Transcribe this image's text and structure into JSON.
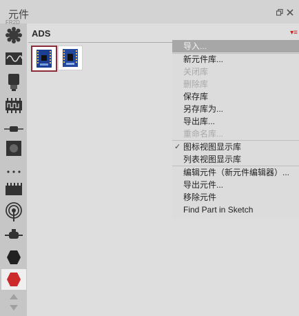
{
  "window": {
    "title": "元件"
  },
  "sidebar": {
    "top_label": "FR2D",
    "icons": [
      "chip-icon",
      "wave-icon",
      "connector-icon",
      "ic-icon",
      "resistor-icon",
      "button-icon",
      "more-icon",
      "ic-dark-icon",
      "antenna-icon",
      "plug-icon",
      "hexagon-dark-icon",
      "hexagon-red-icon",
      "scroll-arrows-icon"
    ],
    "active_color": "#cc2a2a"
  },
  "main": {
    "heading": "ADS",
    "menu_glyph": "▾≡"
  },
  "context_menu": {
    "items": [
      {
        "label": "导入...",
        "state": "highlighted"
      },
      {
        "label": "新元件库...",
        "state": "normal"
      },
      {
        "label": "关闭库",
        "state": "disabled"
      },
      {
        "label": "删除库",
        "state": "disabled"
      },
      {
        "label": "保存库",
        "state": "normal"
      },
      {
        "label": "另存库为...",
        "state": "normal"
      },
      {
        "label": "导出库...",
        "state": "normal"
      },
      {
        "label": "重命名库...",
        "state": "disabled"
      },
      {
        "label": "图标视图显示库",
        "state": "checked"
      },
      {
        "label": "列表视图显示库",
        "state": "normal"
      },
      {
        "label": "编辑元件（新元件编辑器）...",
        "state": "normal"
      },
      {
        "label": "导出元件...",
        "state": "normal"
      },
      {
        "label": "移除元件",
        "state": "normal"
      },
      {
        "label": "Find Part in Sketch",
        "state": "normal"
      }
    ],
    "check_glyph": "✓"
  }
}
